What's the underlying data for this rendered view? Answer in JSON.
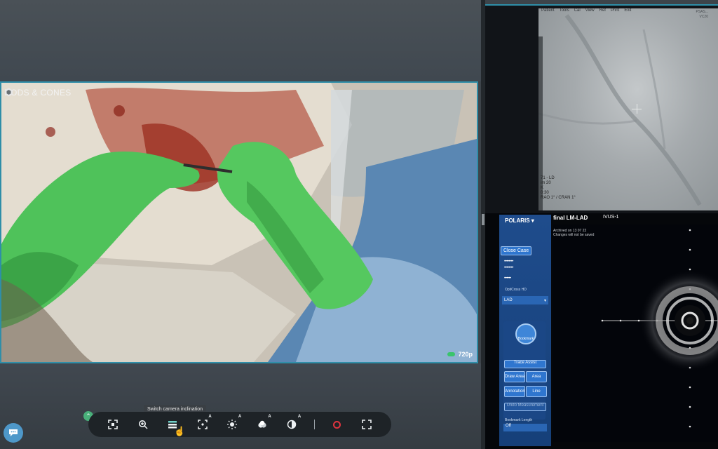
{
  "video": {
    "brand": "RODS & CONES",
    "resolution": "720p"
  },
  "toolbar": {
    "tooltip": "Switch camera inclination",
    "buttons": [
      {
        "name": "focus-icon",
        "glyph": "⌗"
      },
      {
        "name": "zoom-icon",
        "glyph": "⊕"
      },
      {
        "name": "camera-inclination-icon",
        "glyph": "≣"
      },
      {
        "name": "autofocus-icon",
        "glyph": "⌖",
        "badge": "A"
      },
      {
        "name": "brightness-icon",
        "glyph": "☀",
        "badge": "A"
      },
      {
        "name": "white-balance-icon",
        "glyph": "☁",
        "badge": "A"
      },
      {
        "name": "contrast-icon",
        "glyph": "◐",
        "badge": "A"
      },
      {
        "name": "record-icon",
        "glyph": ""
      },
      {
        "name": "fullscreen-icon",
        "glyph": "⛶"
      }
    ]
  },
  "angio": {
    "menu": [
      "Patient",
      "Tools",
      "Cal",
      "View",
      "Ref",
      "Print",
      "Exit"
    ],
    "top_right_1": "PSAS...",
    "top_right_2": "VC20",
    "overlay_line_1": "71 - LD",
    "overlay_line_2": "im 20",
    "overlay_line_3": "K",
    "overlay_line_4": "0:30",
    "overlay_line_5": "RAO 1° / CRAN 1°"
  },
  "ivus": {
    "product": "POLARIS",
    "close_case": "Close Case",
    "masked_1": "••••••••",
    "masked_2": "••••••••",
    "masked_3": "••••••",
    "catheter": "OptiCross HD",
    "vessel": "LAD",
    "bookmark": "Bookmark",
    "trace_assist": "Trace Assist",
    "draw_area": "Draw Area",
    "area": "Area",
    "annotation": "Annotation",
    "line": "Line",
    "undo": "Undo Measurement",
    "bookmark_length_label": "Bookmark Length",
    "bookmark_length_value": "Off",
    "run_name": "final LM-LAD",
    "run_id": "IVUS-1",
    "archived_1": "Archived on 13 07 22",
    "archived_2": "Changes will not be saved"
  }
}
